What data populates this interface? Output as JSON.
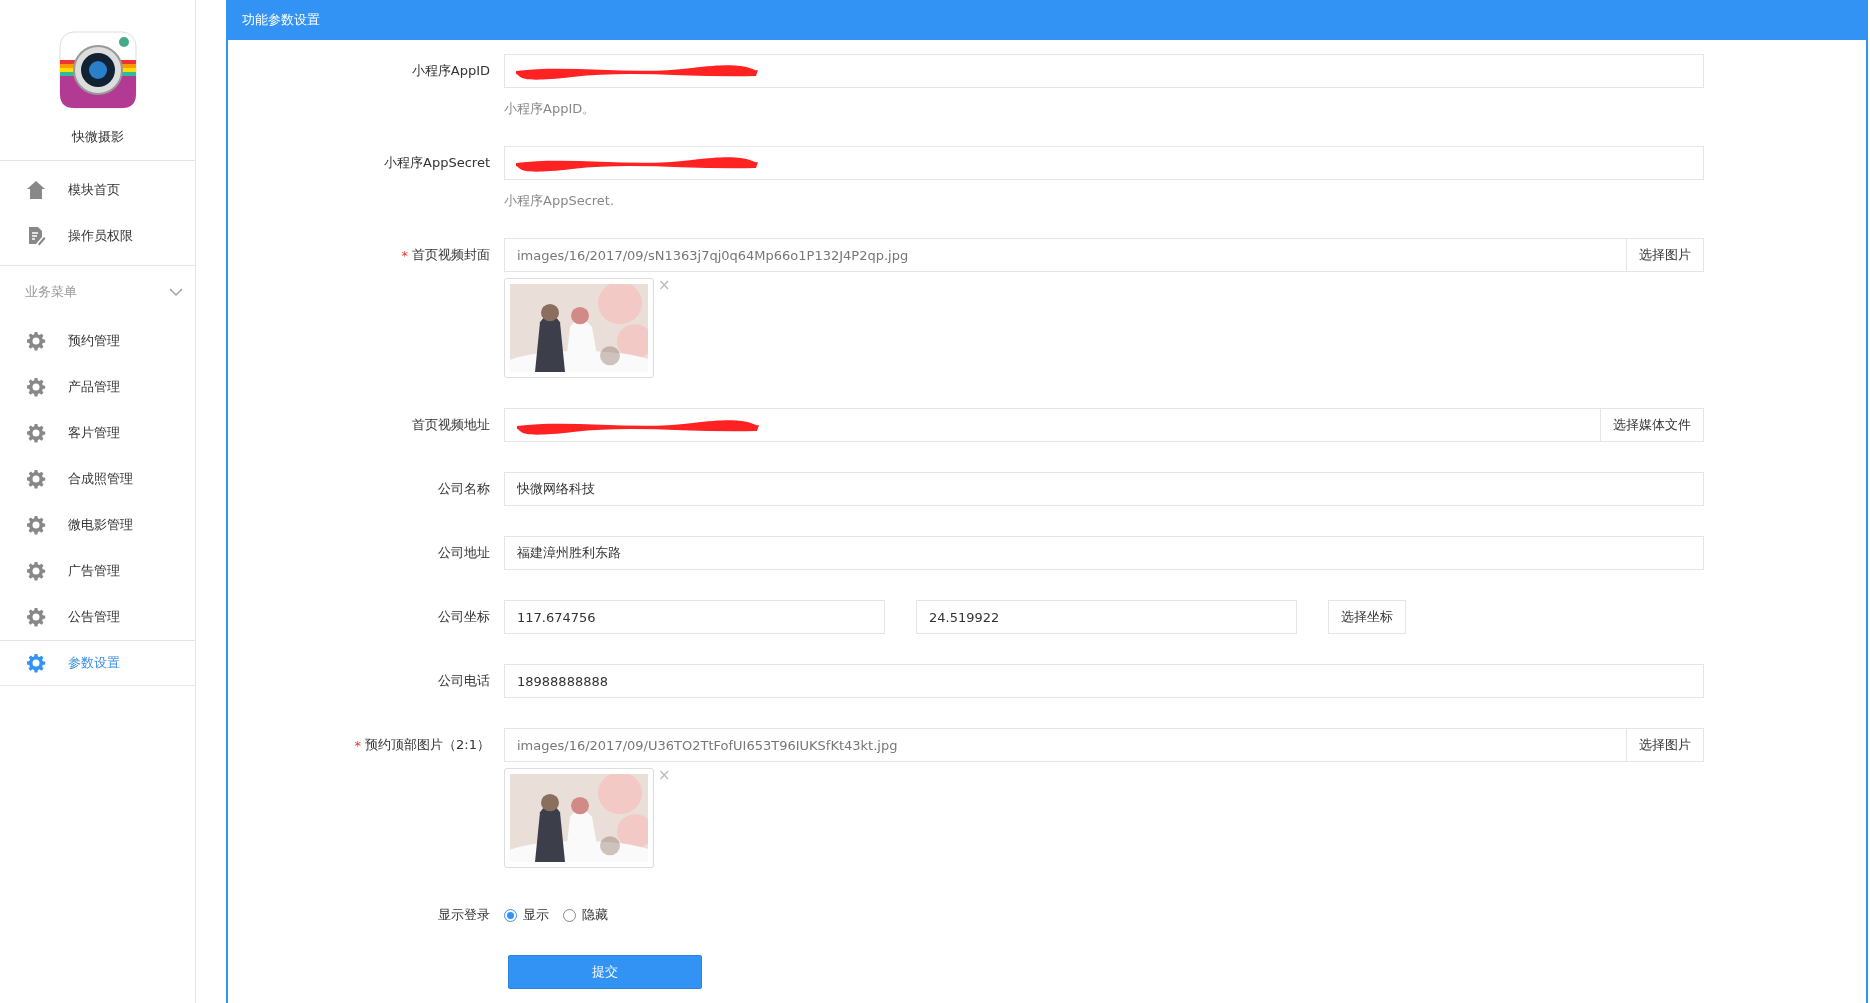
{
  "sidebar": {
    "app_name": "快微摄影",
    "top_items": [
      {
        "label": "模块首页",
        "selected": false
      },
      {
        "label": "操作员权限",
        "selected": false
      }
    ],
    "group": {
      "label": "业务菜单",
      "expanded": true
    },
    "items": [
      {
        "label": "预约管理",
        "selected": false
      },
      {
        "label": "产品管理",
        "selected": false
      },
      {
        "label": "客片管理",
        "selected": false
      },
      {
        "label": "合成照管理",
        "selected": false
      },
      {
        "label": "微电影管理",
        "selected": false
      },
      {
        "label": "广告管理",
        "selected": false
      },
      {
        "label": "公告管理",
        "selected": false
      },
      {
        "label": "参数设置",
        "selected": true
      }
    ]
  },
  "panel": {
    "title": "功能参数设置"
  },
  "fields": [
    {
      "kind": "text",
      "label": "小程序AppID",
      "redacted": true,
      "help": "小程序AppID。"
    },
    {
      "kind": "text",
      "label": "小程序AppSecret",
      "redacted": true,
      "help": "小程序AppSecret."
    },
    {
      "label": "首页视频封面",
      "required_mark": "*",
      "value": "images/16/2017/09/sN1363j7qj0q64Mp66o1P132J4P2qp.jpg",
      "button": "选择图片",
      "remove": "×"
    },
    {
      "kind": "media",
      "label": "首页视频地址",
      "redacted": true,
      "button": "选择媒体文件"
    },
    {
      "kind": "text",
      "label": "公司名称",
      "redacted": false,
      "value": "快微网络科技"
    },
    {
      "kind": "text",
      "label": "公司地址",
      "redacted": false,
      "value": "福建漳州胜利东路"
    },
    {
      "kind": "coords",
      "label": "公司坐标",
      "values": [
        "117.674756",
        "24.519922"
      ],
      "button": "选择坐标"
    },
    {
      "kind": "text",
      "label": "公司电话",
      "redacted": false,
      "value": "18988888888"
    },
    {
      "label": "预约顶部图片（2:1）",
      "required_mark": "*",
      "value": "images/16/2017/09/U36TO2TtFofUI653T96IUKSfKt43kt.jpg",
      "button": "选择图片",
      "remove": "×"
    },
    {
      "kind": "radio",
      "label": "显示登录",
      "options": [
        {
          "label": "显示",
          "selected": true
        },
        {
          "label": "隐藏",
          "selected": false
        }
      ]
    }
  ],
  "submit": "提交"
}
